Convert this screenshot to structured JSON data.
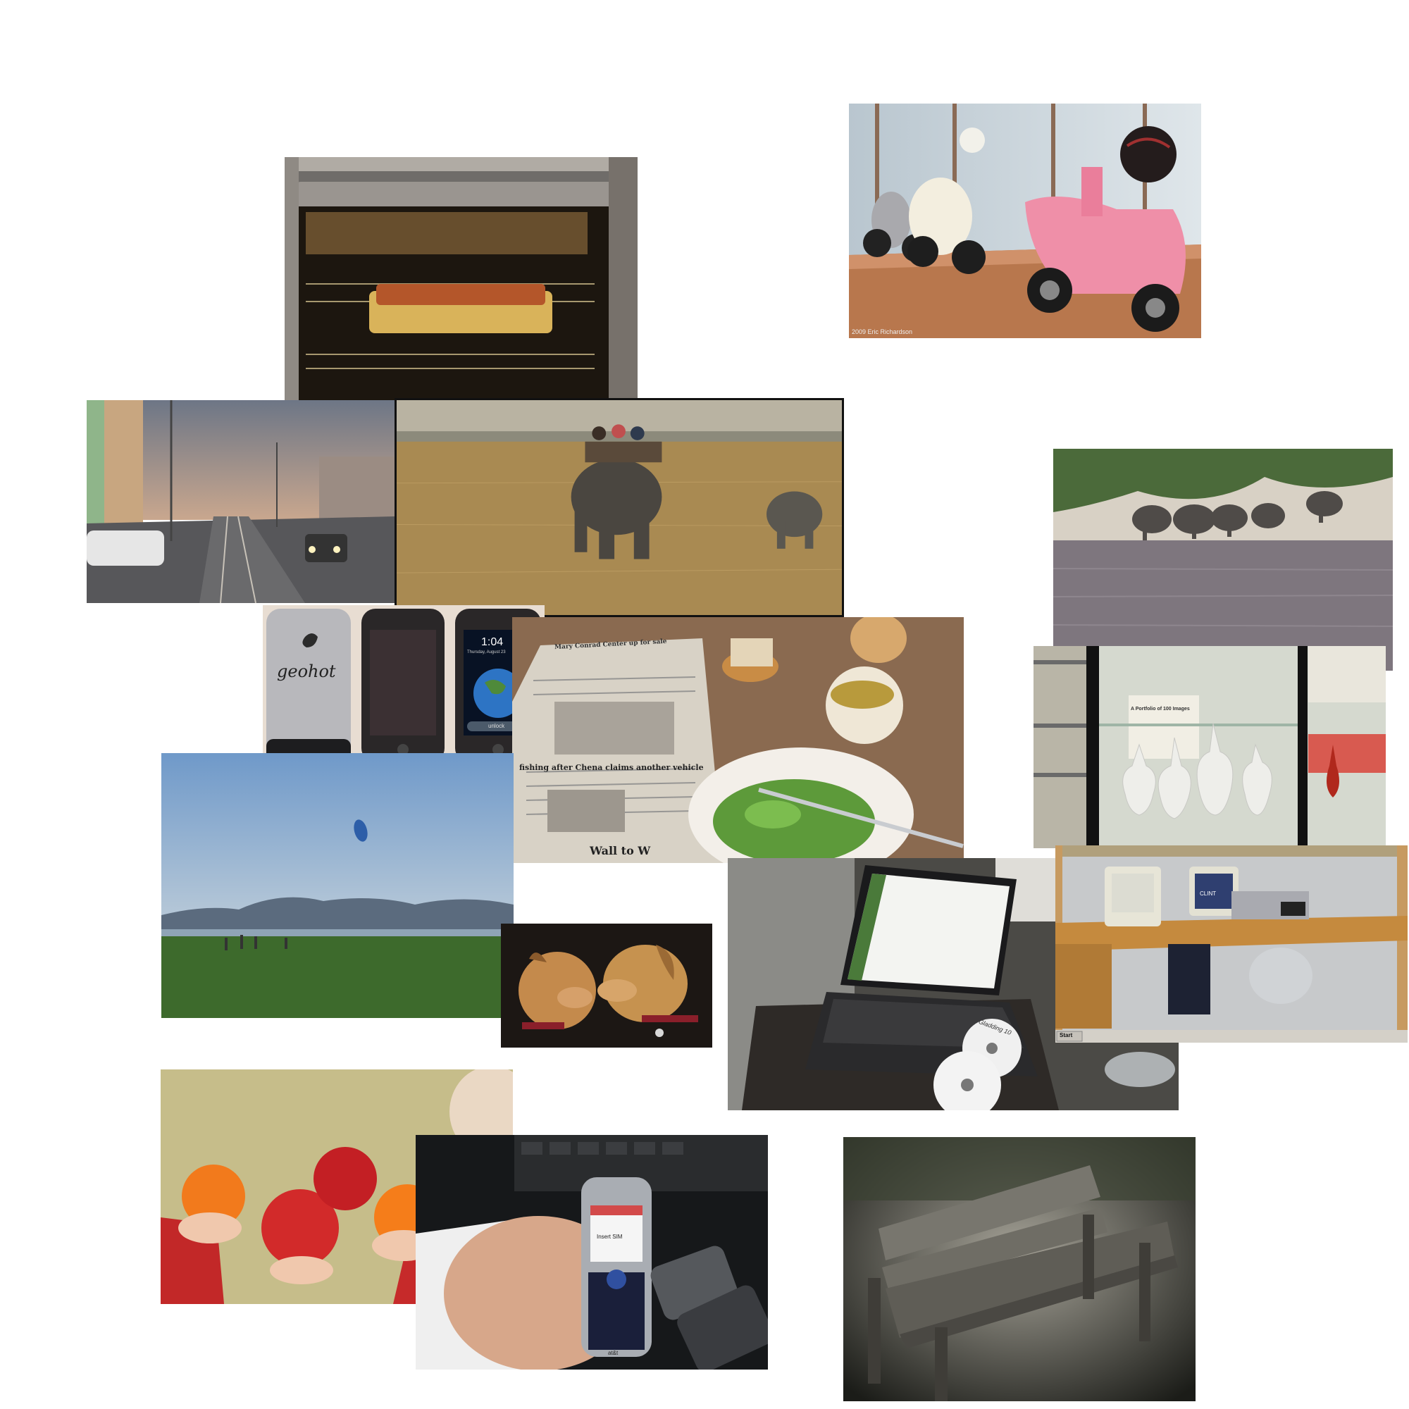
{
  "collage": {
    "photos": [
      {
        "subject": "scooters-in-showroom",
        "credit": "2009 Eric Richardson"
      },
      {
        "subject": "dish-baking-in-oven"
      },
      {
        "subject": "street-with-tram-tracks-at-dusk"
      },
      {
        "subject": "elephant-safari-in-grassland"
      },
      {
        "subject": "elephants-at-river-bank"
      },
      {
        "subject": "three-phones",
        "engraving": "geohot",
        "clock": "1:04",
        "date": "Thursday, August 23",
        "slider": "unlock"
      },
      {
        "subject": "newspaper-with-salad-and-tea",
        "headline_top": "Mary Conrad Center up for sale",
        "headline_mid": "fishing after Chena claims another vehicle",
        "headline_bottom": "Wall to W"
      },
      {
        "subject": "glass-vases-in-display-case",
        "sign_title": "A Portfolio of 100 Images"
      },
      {
        "subject": "kite-over-park-and-hills"
      },
      {
        "subject": "two-dogs-face-to-face"
      },
      {
        "subject": "laptop-with-discs",
        "disc_label": "Gladding 10"
      },
      {
        "subject": "office-cubicle-with-crt-monitors",
        "monitor_text": "CLINT",
        "taskbar_start": "Start"
      },
      {
        "subject": "child-holding-apples-and-oranges"
      },
      {
        "subject": "hand-holding-mobile-phone",
        "phone_screen": "Insert SIM",
        "brand": "at&t"
      },
      {
        "subject": "wooden-park-bench"
      }
    ]
  }
}
